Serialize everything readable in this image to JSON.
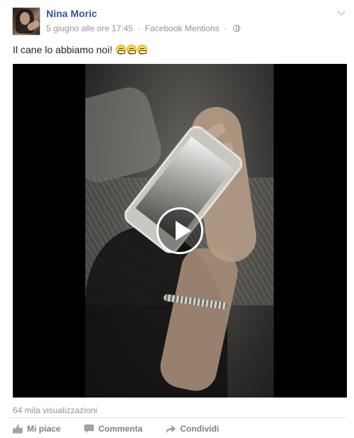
{
  "post": {
    "author": "Nina Moric",
    "date": "5 giugno alle ore 17:45",
    "separator": "·",
    "source": "Facebook Mentions",
    "message": "Il cane lo abbiamo noi!",
    "emoji_count": 3,
    "views": "64 mila visualizzazioni"
  },
  "actions": {
    "like": "Mi piace",
    "comment": "Commenta",
    "share": "Condividi"
  },
  "icons": {
    "like": "thumbs-up-icon",
    "comment": "comment-icon",
    "share": "share-arrow-icon",
    "privacy": "globe-icon",
    "menu": "chevron-down-icon",
    "video": "play-icon"
  },
  "colors": {
    "author": "#365899",
    "meta": "#90949c",
    "actions": "#7f7f7f"
  }
}
